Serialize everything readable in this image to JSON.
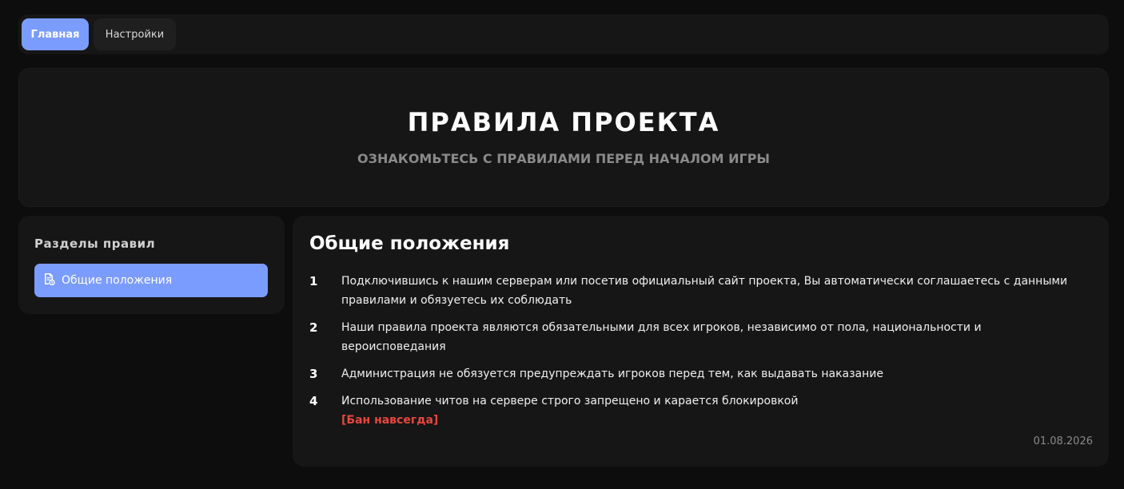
{
  "nav": {
    "tabs": [
      {
        "label": "Главная",
        "active": true
      },
      {
        "label": "Настройки",
        "active": false
      }
    ]
  },
  "hero": {
    "title": "ПРАВИЛА ПРОЕКТА",
    "subtitle": "ОЗНАКОМЬТЕСЬ С ПРАВИЛАМИ ПЕРЕД НАЧАЛОМ ИГРЫ"
  },
  "sidebar": {
    "title": "Разделы правил",
    "items": [
      {
        "label": "Общие положения",
        "icon": "document-icon",
        "active": true
      }
    ]
  },
  "content": {
    "title": "Общие положения",
    "rules": [
      {
        "num": "1",
        "text": "Подключившись к нашим серверам или посетив официальный сайт проекта, Вы автоматически соглашаетесь с данными правилами и обязуетесь их соблюдать",
        "penalty": ""
      },
      {
        "num": "2",
        "text": "Наши правила проекта являются обязательными для всех игроков, независимо от пола, национальности и вероисповедания",
        "penalty": ""
      },
      {
        "num": "3",
        "text": "Администрация не обязуется предупреждать игроков перед тем, как выдавать наказание",
        "penalty": ""
      },
      {
        "num": "4",
        "text": "Использование читов на сервере строго запрещено и карается блокировкой",
        "penalty": "[Бан навсегда]"
      }
    ],
    "date": "01.08.2026"
  },
  "colors": {
    "accent": "#7b9cff",
    "penalty": "#e8473f",
    "panel": "#161616",
    "background": "#0d0d0d"
  }
}
